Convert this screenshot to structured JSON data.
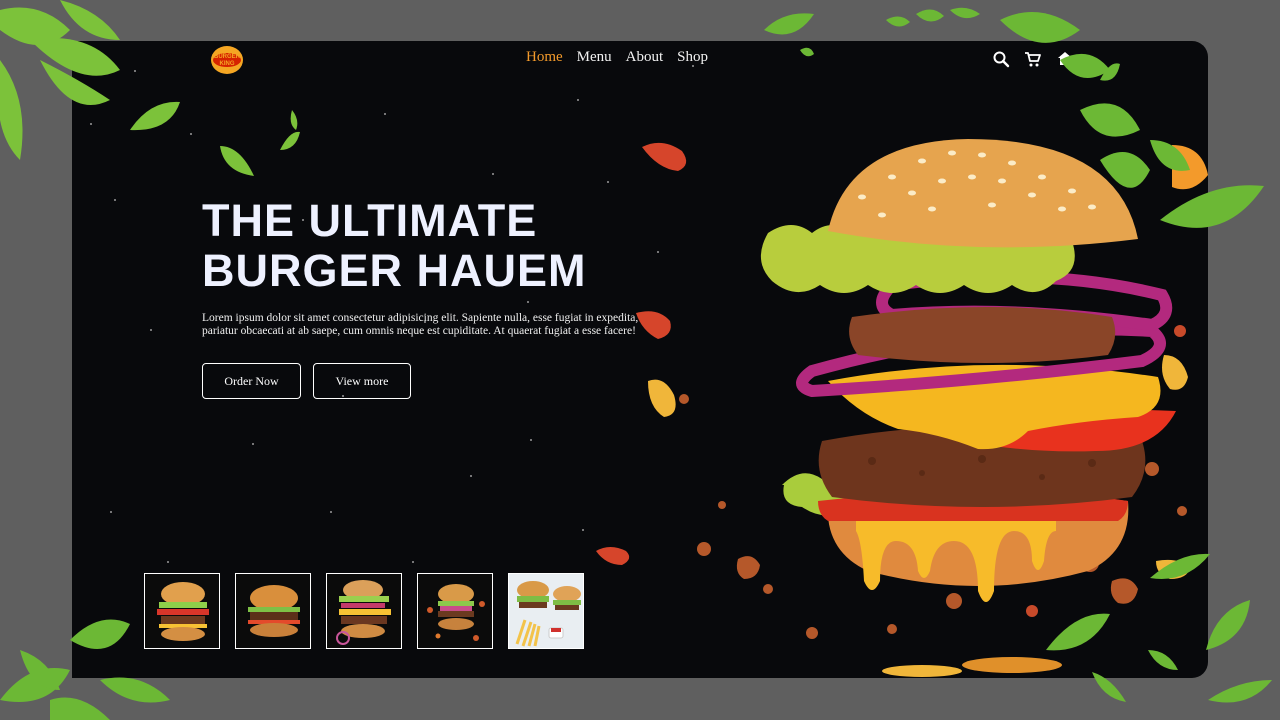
{
  "brand": {
    "logo_text_top": "BURGER",
    "logo_text_bottom": "KING",
    "logo_icon": "burger-king-logo-icon"
  },
  "nav": {
    "items": [
      {
        "label": "Home",
        "active": true
      },
      {
        "label": "Menu",
        "active": false
      },
      {
        "label": "About",
        "active": false
      },
      {
        "label": "Shop",
        "active": false
      }
    ]
  },
  "header_icons": [
    "search-icon",
    "cart-icon",
    "home-icon"
  ],
  "hero": {
    "title_line1": "THE ULTIMATE",
    "title_line2": "BURGER HAUEM",
    "description_line1": "Lorem ipsum dolor sit amet consectetur adipisicing elit. Sapiente nulla, esse fugiat in expedita,",
    "description_line2": "pariatur obcaecati at ab saepe, cum omnis neque est cupiditate. At quaerat fugiat a esse facere!",
    "order_button": "Order Now",
    "view_button": "View more"
  },
  "thumbnails": [
    "burger-thumbnail-1",
    "burger-thumbnail-2",
    "burger-thumbnail-3",
    "burger-thumbnail-4",
    "burger-fries-thumbnail-5"
  ],
  "colors": {
    "background": "#5f5f5f",
    "card": "#08090c",
    "nav_active": "#f39a2b",
    "text": "#f2f2f2",
    "title": "#eef1ff"
  }
}
